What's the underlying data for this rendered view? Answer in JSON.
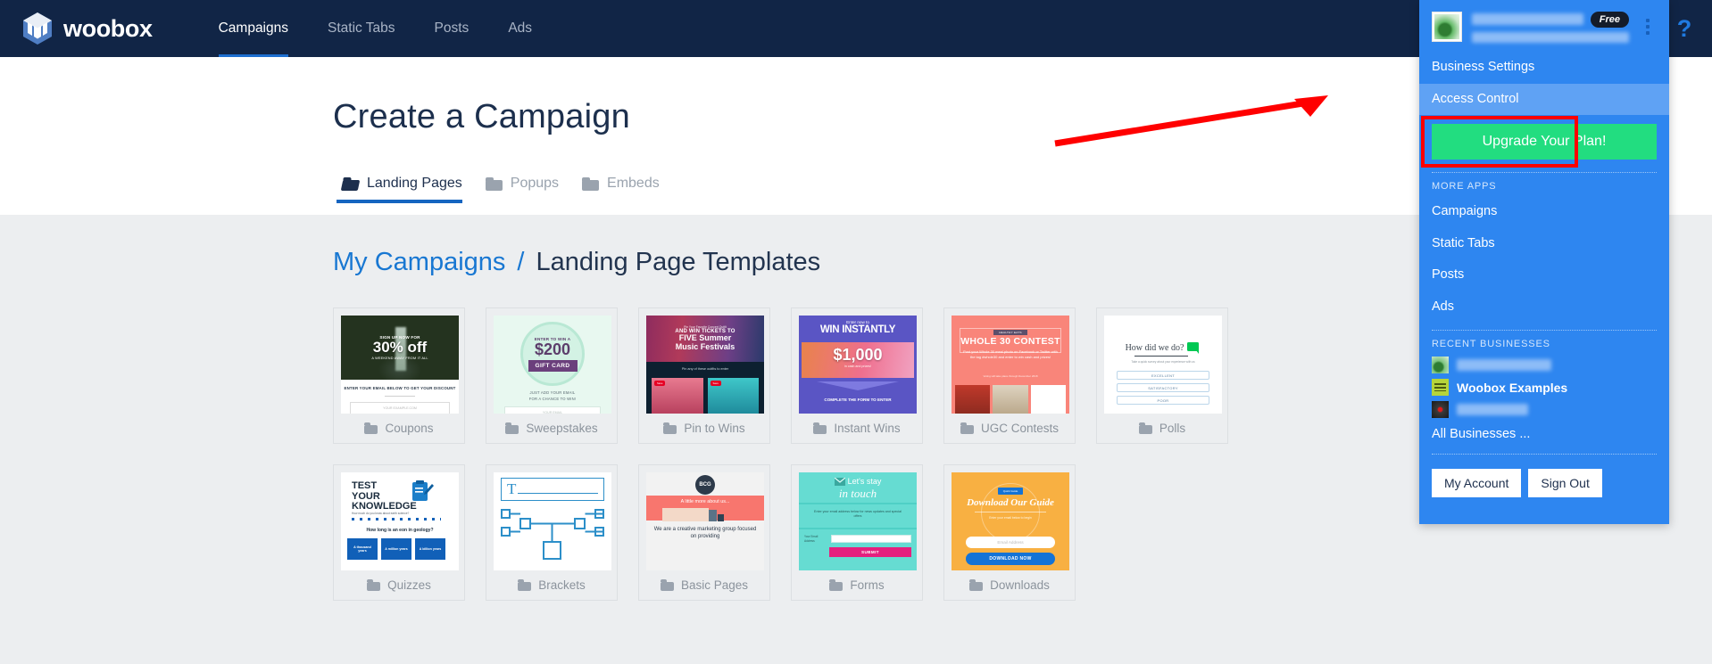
{
  "topnav": {
    "brand": "woobox",
    "logo_icon": "woobox-cube-logo",
    "links": [
      {
        "label": "Campaigns",
        "active": true
      },
      {
        "label": "Static Tabs",
        "active": false
      },
      {
        "label": "Posts",
        "active": false
      },
      {
        "label": "Ads",
        "active": false
      }
    ],
    "help_icon": "question-mark-icon",
    "help_label": "?"
  },
  "page": {
    "title": "Create a Campaign",
    "tabs": [
      {
        "label": "Landing Pages",
        "icon": "open-folder-icon",
        "active": true
      },
      {
        "label": "Popups",
        "icon": "folder-icon",
        "active": false
      },
      {
        "label": "Embeds",
        "icon": "folder-icon",
        "active": false
      }
    ],
    "breadcrumb": {
      "link": "My Campaigns",
      "separator": "/",
      "current": "Landing Page Templates"
    }
  },
  "templates": {
    "row1": [
      {
        "label": "Coupons",
        "thumb": {
          "kicker": "SIGN UP NOW FOR",
          "headline": "30% off",
          "sub": "A WEEKEND AWAY FROM IT ALL",
          "caption": "ENTER YOUR EMAIL BELOW TO GET YOUR DISCOUNT",
          "field": "YOUR EXAMPLE.COM"
        }
      },
      {
        "label": "Sweepstakes",
        "thumb": {
          "kicker": "ENTER TO WIN A",
          "amount": "$200",
          "badge": "GIFT CARD",
          "line1": "JUST ADD YOUR EMAIL",
          "line2": "FOR A CHANCE TO WIN!",
          "field": "YOUR EMAIL"
        }
      },
      {
        "label": "Pin to Wins",
        "thumb": {
          "kicker": "Pin Your Favorite Concert Outfit",
          "line1": "AND WIN TICKETS TO",
          "line2": "FIVE Summer",
          "line3": "Music Festivals",
          "caption": "Pin any of these outfits to enter",
          "pin_badge": "Save"
        }
      },
      {
        "label": "Instant Wins",
        "thumb": {
          "kicker": "Enter now to",
          "headline": "WIN INSTANTLY",
          "amount": "$1,000",
          "sub": "in cash and prizes!",
          "cta": "COMPLETE THE FORM TO ENTER"
        }
      },
      {
        "label": "UGC Contests",
        "thumb": {
          "badge": "HEALTHY EATS",
          "title": "WHOLE 30 CONTEST",
          "body": "Post your Whole 30 meal photo on Facebook or Twitter with the tag #whole30 and enter to win cash and prizes!",
          "note": "Voting will take place through December 2018"
        }
      },
      {
        "label": "Polls",
        "thumb": {
          "title": "How did we do?",
          "sub": "Take a quick survey about your experience with us",
          "options": [
            "EXCELLENT",
            "SATISFACTORY",
            "POOR"
          ],
          "icon": "chat-bubble-icon"
        }
      }
    ],
    "row2": [
      {
        "label": "Quizzes",
        "thumb": {
          "title1": "TEST",
          "title2": "YOUR",
          "title3": "KNOWLEDGE",
          "sub": "How much do you know about earth science?",
          "question": "How long is an eon in geology?",
          "answers": [
            "A thousand years",
            "A million years",
            "A billion years"
          ],
          "icon": "clipboard-pencil-icon"
        }
      },
      {
        "label": "Brackets",
        "thumb": {
          "letter": "T",
          "icon": "bracket-tree-icon"
        }
      },
      {
        "label": "Basic Pages",
        "thumb": {
          "logo": "BCG",
          "headline": "A little more about us...",
          "body": "We are a creative marketing group focused on providing"
        }
      },
      {
        "label": "Forms",
        "thumb": {
          "title1": "Let's stay",
          "title2": "in touch",
          "body": "Enter your email address below for news updates and special offers",
          "field_label": "Your Email Address",
          "submit": "SUBMIT",
          "icon": "envelope-icon"
        }
      },
      {
        "label": "Downloads",
        "thumb": {
          "badge": "Quick Guide",
          "title": "Download Our Guide",
          "sub": "Enter your email below to begin",
          "field": "Email Address",
          "cta": "DOWNLOAD NOW"
        }
      }
    ]
  },
  "dropdown": {
    "free_badge": "Free",
    "kebab_icon": "vertical-dots-icon",
    "avatar_icon": "user-avatar-image",
    "items": [
      {
        "label": "Business Settings",
        "hover": false
      },
      {
        "label": "Access Control",
        "hover": true
      }
    ],
    "upgrade_label": "Upgrade Your Plan!",
    "more_apps_heading": "MORE APPS",
    "more_apps": [
      "Campaigns",
      "Static Tabs",
      "Posts",
      "Ads"
    ],
    "recent_heading": "RECENT BUSINESSES",
    "businesses": [
      {
        "name": "",
        "blurred": true,
        "icon": "business-avatar-green"
      },
      {
        "name": "Woobox Examples",
        "blurred": false,
        "icon": "woobox-logo-icon"
      },
      {
        "name": "",
        "blurred": true,
        "icon": "business-avatar-camera"
      }
    ],
    "all_businesses": "All Businesses ...",
    "my_account": "My Account",
    "sign_out": "Sign Out"
  },
  "annotation": {
    "arrow_color": "#ff0000",
    "highlight_color": "#ff0000",
    "arrow_icon": "red-pointer-arrow"
  },
  "colors": {
    "nav_bg": "#112546",
    "dropdown_bg": "#2e86f0",
    "upgrade_green": "#22dd80",
    "content_bg": "#eceef0",
    "link_blue": "#1877d2"
  }
}
